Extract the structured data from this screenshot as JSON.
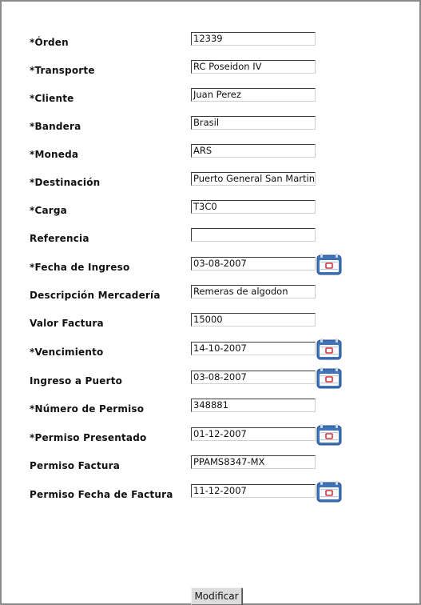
{
  "form": {
    "fields": [
      {
        "label": "*Órden",
        "value": "12339",
        "calendar": false
      },
      {
        "label": "*Transporte",
        "value": "RC Poseidon IV",
        "calendar": false
      },
      {
        "label": "*Cliente",
        "value": "Juan Perez",
        "calendar": false
      },
      {
        "label": "*Bandera",
        "value": "Brasil",
        "calendar": false
      },
      {
        "label": "*Moneda",
        "value": "ARS",
        "calendar": false
      },
      {
        "label": "*Destinación",
        "value": "Puerto General San Martin",
        "calendar": false
      },
      {
        "label": "*Carga",
        "value": "T3C0",
        "calendar": false
      },
      {
        "label": "Referencia",
        "value": "",
        "calendar": false
      },
      {
        "label": "*Fecha de Ingreso",
        "value": "03-08-2007",
        "calendar": true
      },
      {
        "label": "Descripción Mercadería",
        "value": "Remeras de algodon",
        "calendar": false
      },
      {
        "label": "Valor Factura",
        "value": "15000",
        "calendar": false
      },
      {
        "label": "*Vencimiento",
        "value": "14-10-2007",
        "calendar": true
      },
      {
        "label": "Ingreso a Puerto",
        "value": "03-08-2007",
        "calendar": true
      },
      {
        "label": "*Número de Permiso",
        "value": "348881",
        "calendar": false
      },
      {
        "label": "*Permiso Presentado",
        "value": "01-12-2007",
        "calendar": true
      },
      {
        "label": "Permiso Factura",
        "value": "PPAMS8347-MX",
        "calendar": false
      },
      {
        "label": "Permiso Fecha de Factura",
        "value": "11-12-2007",
        "calendar": true
      }
    ],
    "submit_label": "Modificar"
  },
  "icons": {
    "calendar": "calendar-icon"
  },
  "colors": {
    "calendar_blue": "#3f73b8",
    "calendar_red": "#d9333c",
    "button_face": "#dcdcdc"
  }
}
